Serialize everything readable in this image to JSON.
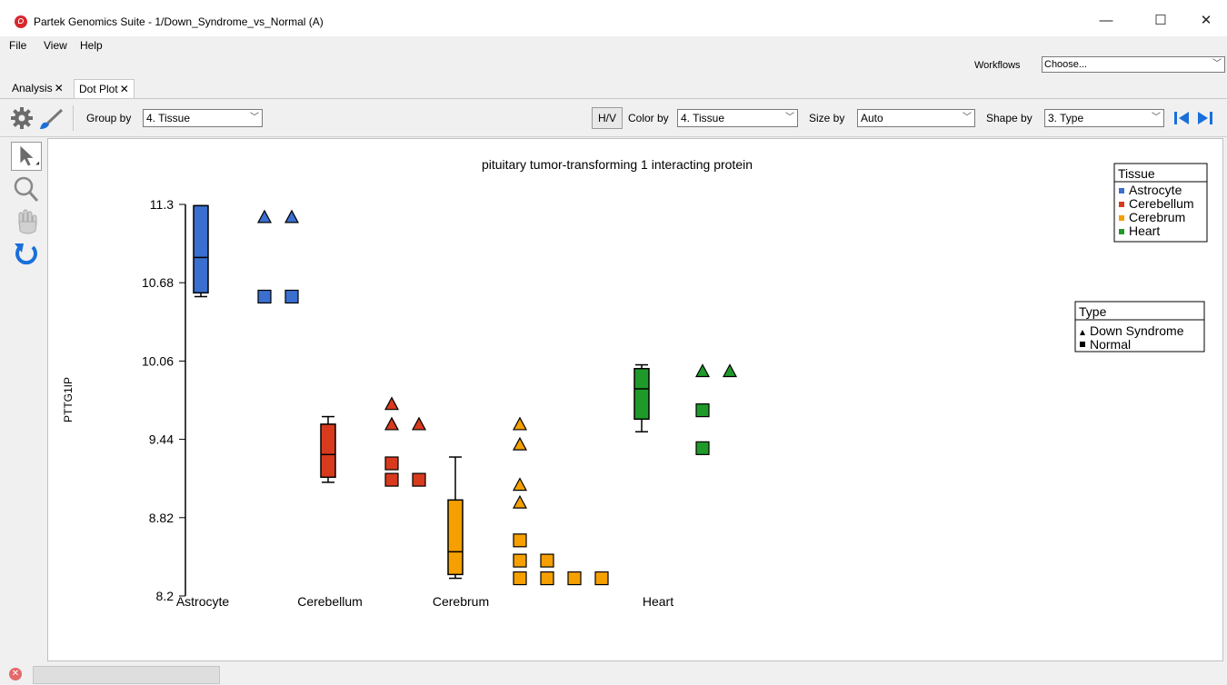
{
  "window": {
    "title": "Partek Genomics Suite - 1/Down_Syndrome_vs_Normal (A)",
    "minimize": "—",
    "maximize": "☐",
    "close": "✕"
  },
  "menu": [
    "File",
    "View",
    "Help"
  ],
  "workflows": {
    "label": "Workflows",
    "value": "Choose..."
  },
  "tabs": [
    {
      "label": "Analysis",
      "close": "✕",
      "active": false
    },
    {
      "label": "Dot Plot",
      "close": "✕",
      "active": true
    }
  ],
  "toolbar": {
    "group_by_label": "Group by",
    "group_by_value": "4. Tissue",
    "hv_label": "H/V",
    "color_by_label": "Color by",
    "color_by_value": "4. Tissue",
    "size_by_label": "Size by",
    "size_by_value": "Auto",
    "shape_by_label": "Shape by",
    "shape_by_value": "3. Type"
  },
  "chart_data": {
    "type": "scatter",
    "title": "pituitary tumor-transforming 1 interacting protein",
    "ylabel": "PTTG1IP",
    "ylim": [
      8.2,
      11.3
    ],
    "yticks": [
      "11.3",
      "10.68",
      "10.06",
      "9.44",
      "8.82",
      "8.2"
    ],
    "categories": [
      "Astrocyte",
      "Cerebellum",
      "Cerebrum",
      "Heart"
    ],
    "colors": {
      "Astrocyte": "#3a6fd0",
      "Cerebellum": "#d83a1e",
      "Cerebrum": "#f5a000",
      "Heart": "#1f9a2a"
    },
    "boxes": [
      {
        "group": "Astrocyte",
        "min": 10.57,
        "q1": 10.6,
        "median": 10.88,
        "q3": 11.29,
        "max": 11.29
      },
      {
        "group": "Cerebellum",
        "min": 9.1,
        "q1": 9.14,
        "median": 9.32,
        "q3": 9.56,
        "max": 9.62
      },
      {
        "group": "Cerebrum",
        "min": 8.34,
        "q1": 8.37,
        "median": 8.55,
        "q3": 8.96,
        "max": 9.3
      },
      {
        "group": "Heart",
        "min": 9.5,
        "q1": 9.6,
        "median": 9.84,
        "q3": 10.0,
        "max": 10.03
      }
    ],
    "points": [
      {
        "group": "Astrocyte",
        "type": "Down Syndrome",
        "values": [
          11.2,
          11.2
        ]
      },
      {
        "group": "Astrocyte",
        "type": "Normal",
        "values": [
          10.57,
          10.57
        ]
      },
      {
        "group": "Cerebellum",
        "type": "Down Syndrome",
        "values": [
          9.72,
          9.56,
          9.56
        ]
      },
      {
        "group": "Cerebellum",
        "type": "Normal",
        "values": [
          9.25,
          9.12,
          9.12
        ]
      },
      {
        "group": "Cerebrum",
        "type": "Down Syndrome",
        "values": [
          9.56,
          9.4,
          9.08,
          8.94
        ]
      },
      {
        "group": "Cerebrum",
        "type": "Normal",
        "values": [
          8.64,
          8.48,
          8.48,
          8.34,
          8.34,
          8.34,
          8.34
        ]
      },
      {
        "group": "Heart",
        "type": "Down Syndrome",
        "values": [
          9.98,
          9.98
        ]
      },
      {
        "group": "Heart",
        "type": "Normal",
        "values": [
          9.67,
          9.37
        ]
      }
    ],
    "legend_tissue": {
      "title": "Tissue",
      "items": [
        "Astrocyte",
        "Cerebellum",
        "Cerebrum",
        "Heart"
      ]
    },
    "legend_type": {
      "title": "Type",
      "items": [
        {
          "label": "Down Syndrome",
          "shape": "triangle"
        },
        {
          "label": "Normal",
          "shape": "square"
        }
      ]
    }
  }
}
